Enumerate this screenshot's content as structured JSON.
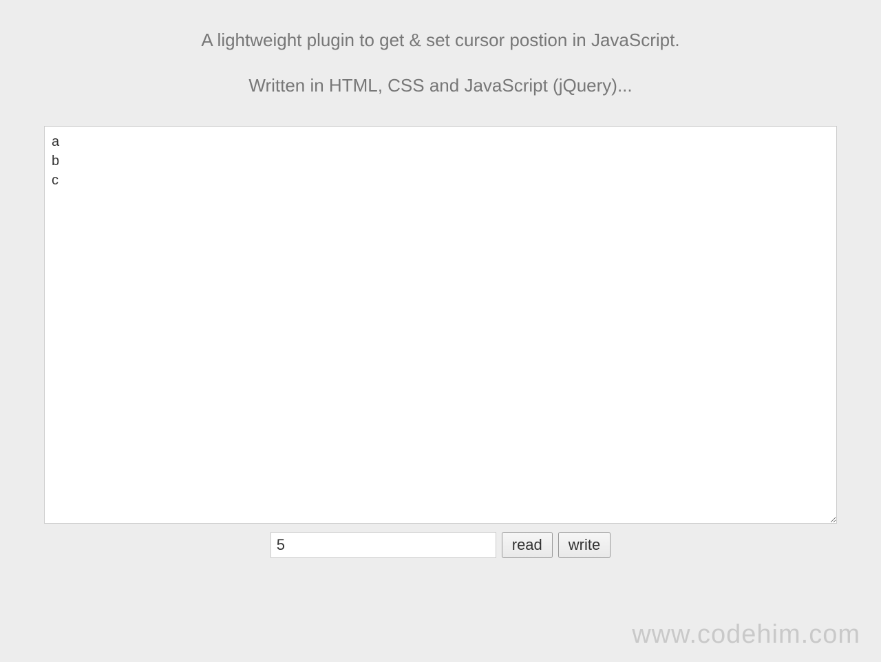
{
  "header": {
    "title": "A lightweight plugin to get & set cursor postion in JavaScript.",
    "subtitle": "Written in HTML, CSS and JavaScript (jQuery)..."
  },
  "textarea": {
    "value": "a\nb\nc"
  },
  "controls": {
    "position_value": "5",
    "read_label": "read",
    "write_label": "write"
  },
  "watermark": {
    "text": "www.codehim.com"
  }
}
